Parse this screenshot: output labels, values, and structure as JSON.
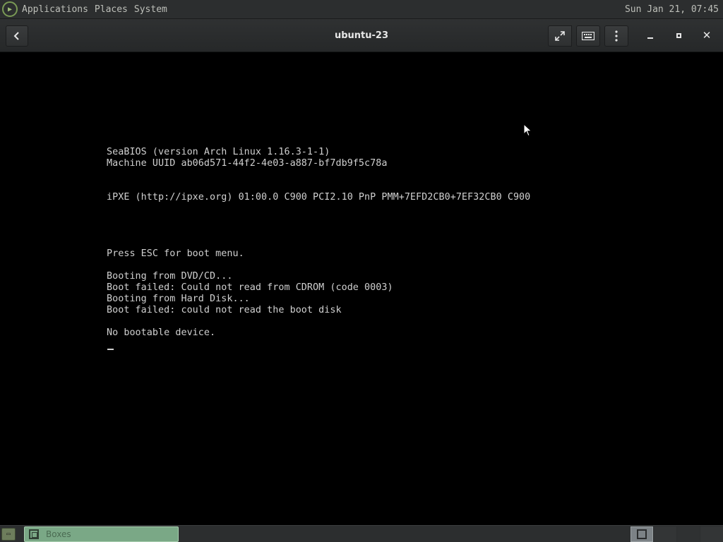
{
  "top_panel": {
    "logo_icon": "gnome-foot-icon",
    "menus": [
      "Applications",
      "Places",
      "System"
    ],
    "clock": "Sun Jan 21, 07:45"
  },
  "header_bar": {
    "title": "ubuntu-23",
    "back_icon": "chevron-left-icon",
    "fullscreen_icon": "fullscreen-icon",
    "keyboard_icon": "keyboard-icon",
    "menu_icon": "vertical-dots-icon",
    "minimize_icon": "minimize-icon",
    "maximize_icon": "maximize-icon",
    "close_icon": "close-icon"
  },
  "console": {
    "lines": [
      "SeaBIOS (version Arch Linux 1.16.3-1-1)",
      "Machine UUID ab06d571-44f2-4e03-a887-bf7db9f5c78a",
      "iPXE (http://ipxe.org) 01:00.0 C900 PCI2.10 PnP PMM+7EFD2CB0+7EF32CB0 C900",
      "Press ESC for boot menu.",
      "Booting from DVD/CD...",
      "Boot failed: Could not read from CDROM (code 0003)",
      "Booting from Hard Disk...",
      "Boot failed: could not read the boot disk",
      "No bootable device."
    ]
  },
  "bottom_panel": {
    "show_desktop_icon": "show-desktop-icon",
    "tasks": [
      {
        "label": "Boxes",
        "icon": "boxes-app-icon"
      }
    ],
    "workspaces": 4,
    "active_workspace": 1
  }
}
